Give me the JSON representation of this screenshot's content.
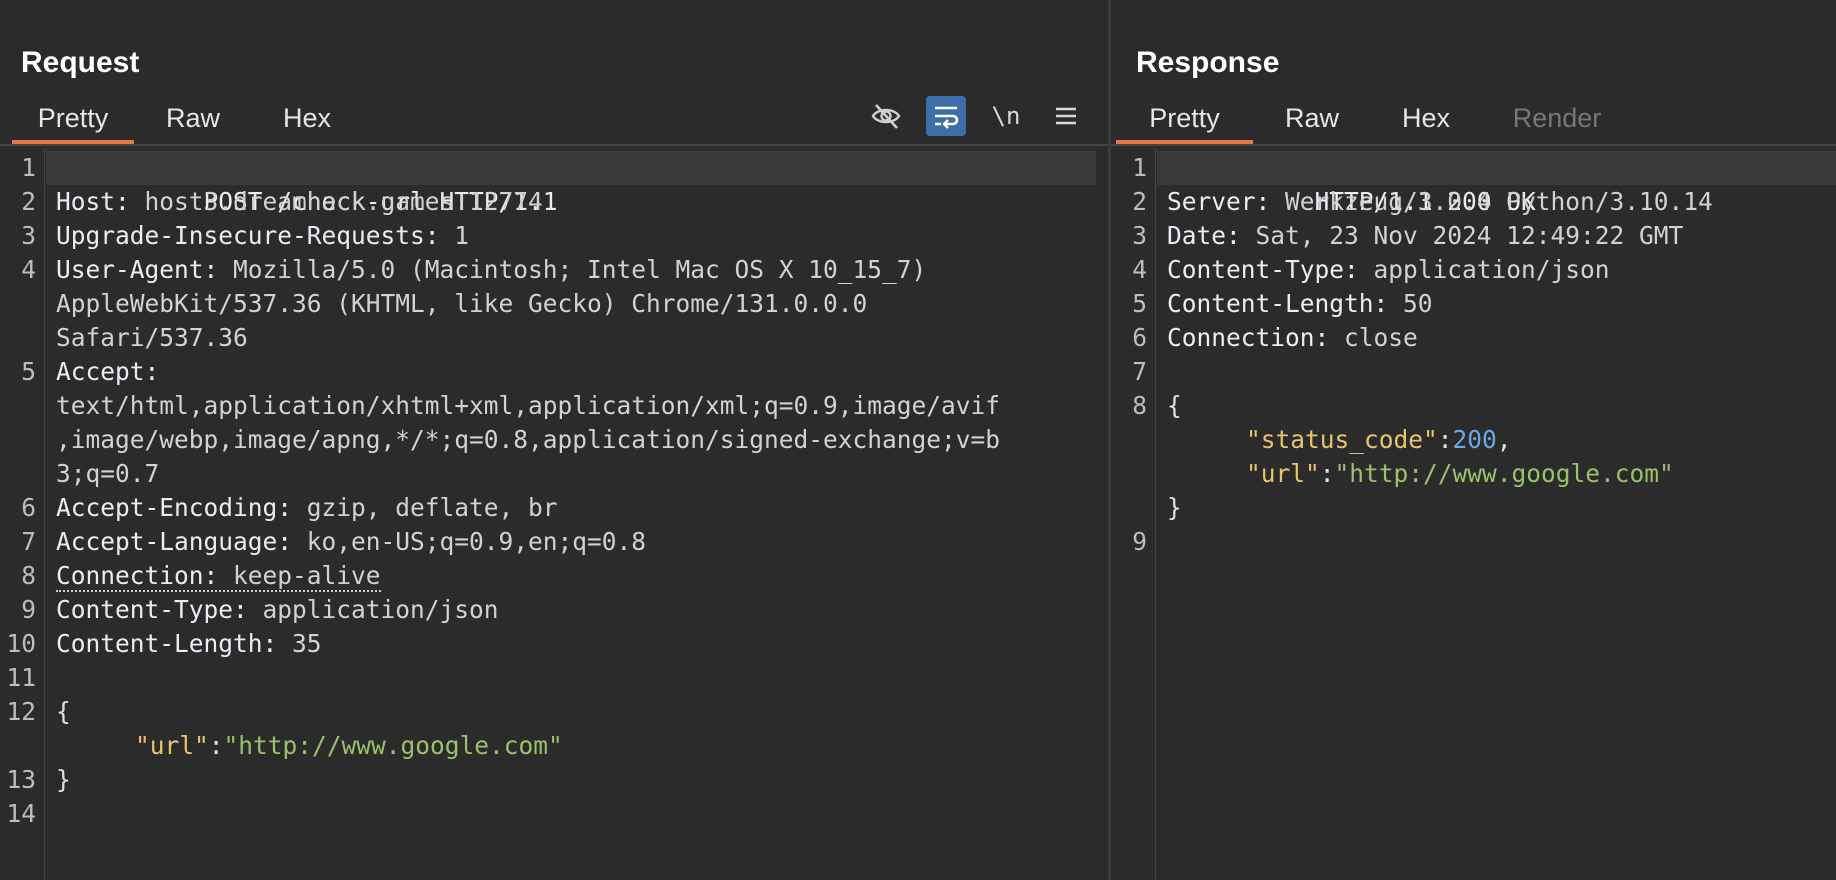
{
  "request": {
    "title": "Request",
    "tabs": [
      "Pretty",
      "Raw",
      "Hex"
    ],
    "active_tab": "Pretty",
    "toolbar": {
      "hide_icon": "eye-off-icon",
      "wrap_icon": "word-wrap-icon",
      "newline_label": "\\n",
      "menu_icon": "hamburger-menu-icon"
    },
    "line_numbers": [
      "1",
      "2",
      "3",
      "4",
      "5",
      "6",
      "7",
      "8",
      "9",
      "10",
      "11",
      "12",
      "13",
      "14"
    ],
    "lines": {
      "l1": "POST /check-url HTTP/1.1",
      "l2_name": "Host:",
      "l2_val": " host3.dreamhack.games:12774",
      "l3_name": "Upgrade-Insecure-Requests:",
      "l3_val": " 1",
      "l4_name": "User-Agent:",
      "l4_val": " Mozilla/5.0 (Macintosh; Intel Mac OS X 10_15_7)",
      "l4_wrap1": "AppleWebKit/537.36 (KHTML, like Gecko) Chrome/131.0.0.0",
      "l4_wrap2": "Safari/537.36",
      "l5_name": "Accept:",
      "l5_wrap1": "text/html,application/xhtml+xml,application/xml;q=0.9,image/avif",
      "l5_wrap2": ",image/webp,image/apng,*/*;q=0.8,application/signed-exchange;v=b",
      "l5_wrap3": "3;q=0.7",
      "l6_name": "Accept-Encoding:",
      "l6_val": " gzip, deflate, br",
      "l7_name": "Accept-Language:",
      "l7_val": " ko,en-US;q=0.9,en;q=0.8",
      "l8_name": "Connection:",
      "l8_val": " keep-alive",
      "l9_name": "Content-Type:",
      "l9_val": " application/json",
      "l10_name": "Content-Length:",
      "l10_val": " 35",
      "l12": "{",
      "l12_key": "\"url\"",
      "l12_colon": ":",
      "l12_str": "\"http://www.google.com\"",
      "l13": "}"
    }
  },
  "response": {
    "title": "Response",
    "tabs": [
      "Pretty",
      "Raw",
      "Hex",
      "Render"
    ],
    "active_tab": "Pretty",
    "line_numbers": [
      "1",
      "2",
      "3",
      "4",
      "5",
      "6",
      "7",
      "8",
      "9"
    ],
    "lines": {
      "l1": "HTTP/1.1 200 OK",
      "l2_name": "Server:",
      "l2_val": " Werkzeug/3.0.4 Python/3.10.14",
      "l3_name": "Date:",
      "l3_val": " Sat, 23 Nov 2024 12:49:22 GMT",
      "l4_name": "Content-Type:",
      "l4_val": " application/json",
      "l5_name": "Content-Length:",
      "l5_val": " 50",
      "l6_name": "Connection:",
      "l6_val": " close",
      "l8": "{",
      "l8_key1": "\"status_code\"",
      "l8_colon1": ":",
      "l8_num": "200",
      "l8_comma": ",",
      "l8_key2": "\"url\"",
      "l8_colon2": ":",
      "l8_str": "\"http://www.google.com\"",
      "l8_close": "}"
    }
  },
  "colors": {
    "accent_tab": "#e3774a",
    "active_tool": "#3d6ea8",
    "json_key": "#e8c46a",
    "json_string": "#98c26b",
    "json_number": "#6aa7e8"
  }
}
